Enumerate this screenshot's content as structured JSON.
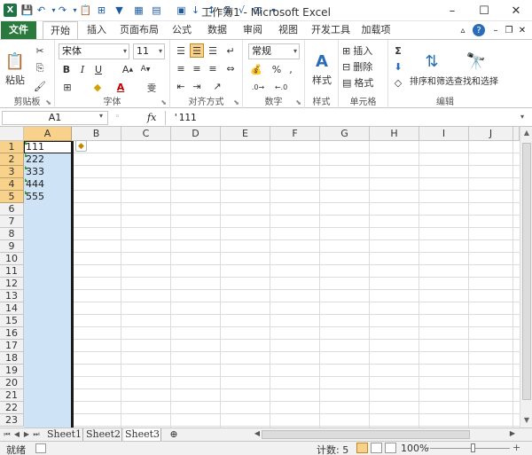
{
  "window": {
    "title": "工作簿1 - Microsoft Excel",
    "minimize": "–",
    "maximize": "☐",
    "close": "✕"
  },
  "ribbon_tabs": [
    "文件",
    "开始",
    "插入",
    "页面布局",
    "公式",
    "数据",
    "审阅",
    "视图",
    "开发工具",
    "加载项"
  ],
  "ribbon": {
    "clipboard": {
      "label": "剪贴板",
      "paste": "粘贴"
    },
    "font": {
      "label": "字体",
      "name": "宋体",
      "size": "11",
      "bold": "B",
      "italic": "I",
      "underline": "U"
    },
    "alignment": {
      "label": "对齐方式"
    },
    "number": {
      "label": "数字",
      "format": "常规",
      "percent": "%",
      "comma": ","
    },
    "styles": {
      "label": "样式",
      "button": "样式"
    },
    "cells": {
      "label": "单元格",
      "insert": "插入",
      "delete": "删除",
      "format": "格式"
    },
    "editing": {
      "label": "编辑",
      "sort": "排序和筛选",
      "find": "查找和选择",
      "sum": "Σ"
    }
  },
  "formula_bar": {
    "name_box": "A1",
    "fx": "fx",
    "content": "'111"
  },
  "columns": [
    "A",
    "B",
    "C",
    "D",
    "E",
    "F",
    "G",
    "H",
    "I",
    "J"
  ],
  "rows": [
    "1",
    "2",
    "3",
    "4",
    "5",
    "6",
    "7",
    "8",
    "9",
    "10",
    "11",
    "12",
    "13",
    "14",
    "15",
    "16",
    "17",
    "18",
    "19",
    "20",
    "21",
    "22",
    "23"
  ],
  "cells": {
    "A1": "111",
    "A2": "222",
    "A3": "333",
    "A4": "444",
    "A5": "555"
  },
  "sheets": [
    "Sheet1",
    "Sheet2",
    "Sheet3"
  ],
  "status": {
    "ready": "就绪",
    "count": "计数: 5",
    "zoom": "100%",
    "zoom_minus": "–",
    "zoom_plus": "+"
  },
  "colors": {
    "file_tab": "#2a7a3d",
    "selection_fill": "#cfe3f7",
    "header_highlight": "#f8d28a",
    "error_indicator": "#339933"
  }
}
